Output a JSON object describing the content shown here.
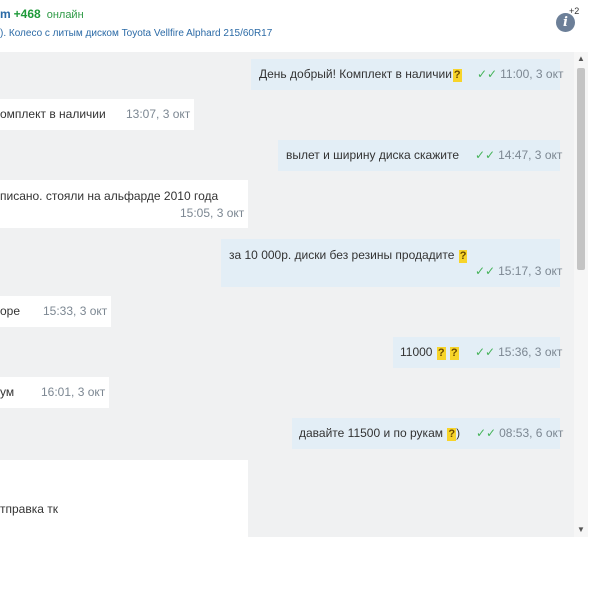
{
  "header": {
    "user_name": "m",
    "user_rating": "+468",
    "user_status": "онлайн",
    "subject_prefix": ").",
    "subject_link": "Колесо с литым диском Toyota Vellfire Alphard 215/60R17",
    "info_icon": "info-icon",
    "info_count": "+2"
  },
  "messages": [
    {
      "dir": "out",
      "text": "День добрый! Комплект в наличии",
      "emoji": "?",
      "time": "11:00, 3 окт"
    },
    {
      "dir": "in",
      "text": "омплект в наличии",
      "time": "13:07, 3 окт"
    },
    {
      "dir": "out",
      "text": "вылет и ширину диска скажите",
      "time": "14:47, 3 окт"
    },
    {
      "dir": "in",
      "text": "писано. стояли на альфарде 2010 года",
      "time": "15:05, 3 окт"
    },
    {
      "dir": "out",
      "text": "за 10 000р. диски без резины продадите",
      "emoji": "?",
      "time": "15:17, 3 окт"
    },
    {
      "dir": "in",
      "text": "оре",
      "time": "15:33, 3 окт"
    },
    {
      "dir": "out",
      "text": "11000",
      "emoji": "?",
      "emoji2": "?",
      "time": "15:36, 3 окт"
    },
    {
      "dir": "in",
      "text": "ум",
      "time": "16:01, 3 окт"
    },
    {
      "dir": "out",
      "text": "давайте 11500 и по рукам",
      "emoji": "?",
      "suffix": ")",
      "time": "08:53, 6 окт"
    },
    {
      "dir": "in",
      "text": "тправка тк"
    }
  ],
  "icons": {
    "check": "double-check-icon",
    "scroll_up": "arrow-up-icon",
    "scroll_down": "arrow-down-icon"
  }
}
